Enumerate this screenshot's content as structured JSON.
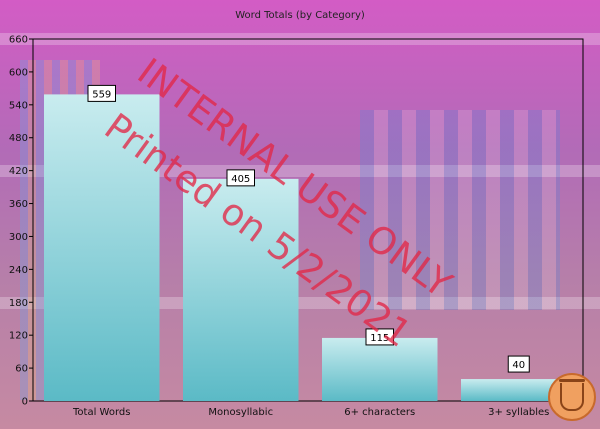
{
  "chart_data": {
    "type": "bar",
    "title": "Word Totals (by Category)",
    "categories": [
      "Total Words",
      "Monosyllabic",
      "6+ characters",
      "3+ syllables"
    ],
    "values": [
      559,
      405,
      115,
      40
    ],
    "ylim": [
      0,
      660
    ],
    "yticks": [
      0,
      60,
      120,
      180,
      240,
      300,
      360,
      420,
      480,
      540,
      600,
      660
    ],
    "xlabel": "",
    "ylabel": "",
    "grid": false
  },
  "watermark": {
    "line1": "INTERNAL USE ONLY",
    "line2": "Printed on 5/2/2021"
  },
  "colors": {
    "bar_top": "#c9ecef",
    "bar_bottom": "#5bbac6",
    "watermark": "#e2283f"
  },
  "icons": {
    "corner_seal": "coffee-cup-icon"
  }
}
